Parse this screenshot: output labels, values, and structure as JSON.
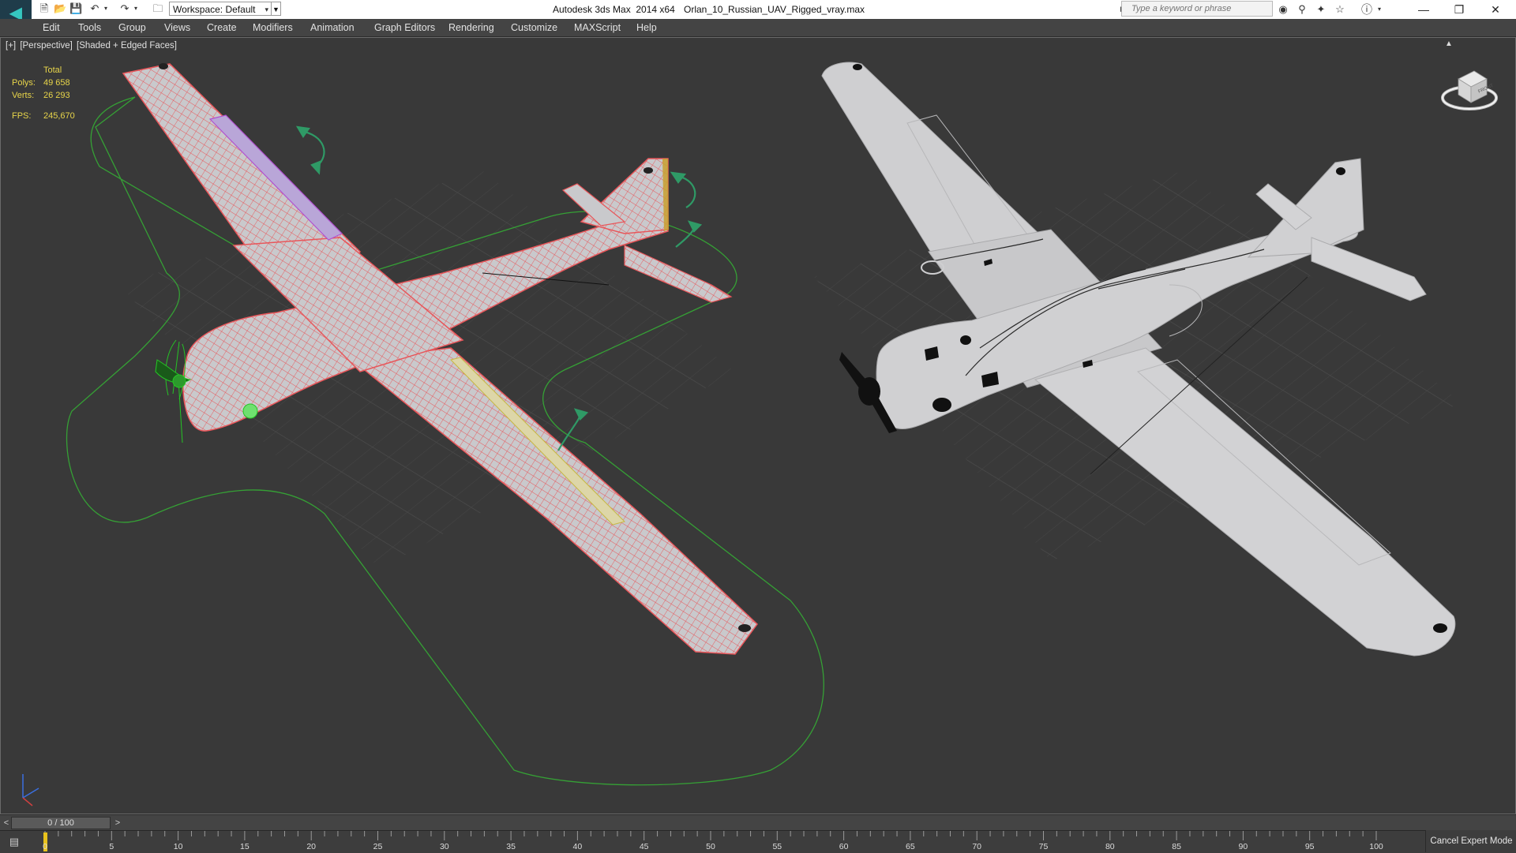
{
  "title_bar": {
    "app_title": "Autodesk 3ds Max  2014 x64",
    "doc_title": "Orlan_10_Russian_UAV_Rigged_vray.max",
    "workspace": "Workspace: Default",
    "search_placeholder": "Type a keyword or phrase",
    "quick_access_icons": [
      "new-file-icon",
      "open-file-icon",
      "save-icon",
      "undo-icon",
      "redo-icon",
      "project-folder-icon"
    ],
    "toolbar_icons": [
      "binoculars-icon",
      "key-icon",
      "favorites-icon",
      "star-icon",
      "help-icon"
    ],
    "window_controls": [
      "minimize",
      "restore",
      "close"
    ]
  },
  "menu": [
    "Edit",
    "Tools",
    "Group",
    "Views",
    "Create",
    "Modifiers",
    "Animation",
    "Graph Editors",
    "Rendering",
    "Customize",
    "MAXScript",
    "Help"
  ],
  "viewport": {
    "label_plus": "[+]",
    "label_view": "[Perspective]",
    "label_shading": "[Shaded + Edged Faces]",
    "stats_total": "Total",
    "polys_label": "Polys:",
    "polys_value": "49 658",
    "verts_label": "Verts:",
    "verts_value": "26 293",
    "fps_label": "FPS:",
    "fps_value": "245,670",
    "viewcube_face": "FRONT"
  },
  "timeline": {
    "position": "0 / 100",
    "current_frame": 0,
    "ticks": [
      0,
      5,
      10,
      15,
      20,
      25,
      30,
      35,
      40,
      45,
      50,
      55,
      60,
      65,
      70,
      75,
      80,
      85,
      90,
      95,
      100
    ]
  },
  "status": {
    "cancel_expert": "Cancel Expert Mode"
  },
  "colors": {
    "wireframe": "#e8565a",
    "mesh_fill": "#c9c9cc",
    "selection_curve": "#35a035",
    "gizmo": "#2f9a66",
    "grid": "#4d4d4d",
    "stats_text": "#e8d54a",
    "viewport_bg": "#393939"
  }
}
